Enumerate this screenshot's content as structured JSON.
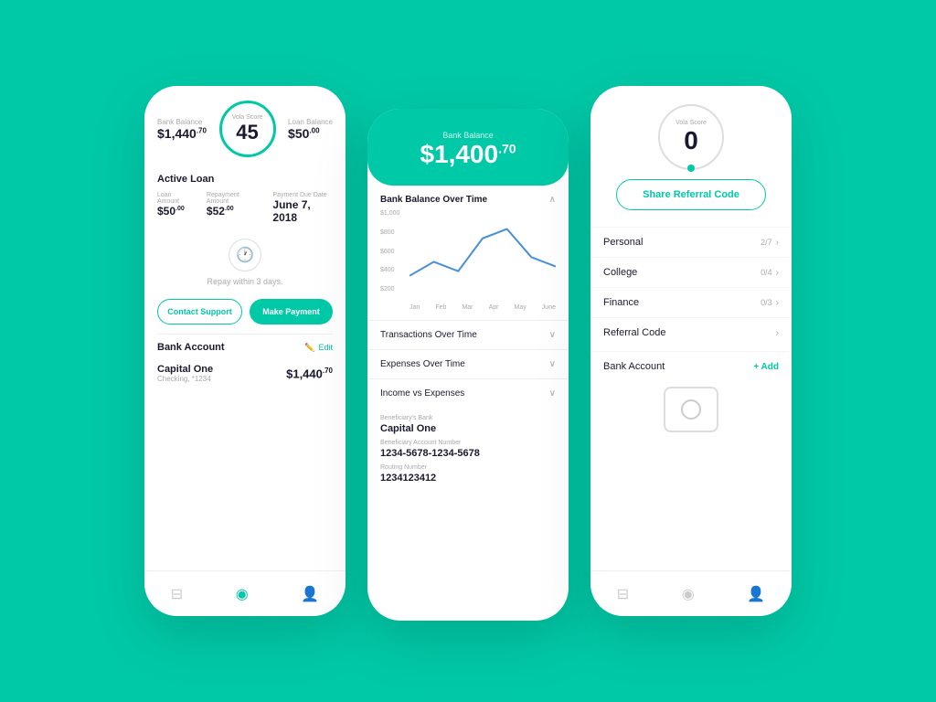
{
  "bg_color": "#00C9A7",
  "phone1": {
    "bank_balance_label": "Bank Balance",
    "bank_balance": "$1,440",
    "bank_balance_sup": ".70",
    "vola_label": "Vola Score",
    "vola_score": "45",
    "loan_balance_label": "Loan Balance",
    "loan_balance": "$50",
    "loan_balance_sup": ".00",
    "active_loan_title": "Active Loan",
    "loan_amount_label": "Loan Amount",
    "loan_amount": "$50",
    "loan_amount_sup": ".00",
    "repayment_label": "Repayment Amount",
    "repayment": "$52",
    "repayment_sup": ".00",
    "due_date_label": "Payment Due Date",
    "due_date": "June 7, 2018",
    "repay_text": "Repay within 3 days.",
    "contact_btn": "Contact Support",
    "payment_btn": "Make Payment",
    "bank_account_title": "Bank Account",
    "edit_label": "Edit",
    "bank_name": "Capital One",
    "bank_type": "Checking, *1234",
    "bank_balance_value": "$1,440",
    "bank_balance_value_sup": ".70"
  },
  "phone2": {
    "bank_balance_label": "Bank Balance",
    "bank_balance": "$1,400",
    "bank_balance_sup": ".70",
    "chart_title": "Bank Balance Over Time",
    "chart_y_labels": [
      "$1,000",
      "$800",
      "$600",
      "$400",
      "$200"
    ],
    "chart_x_labels": [
      "Jan",
      "Feb",
      "Mar",
      "Apr",
      "May",
      "June"
    ],
    "accordions": [
      {
        "label": "Transactions Over Time"
      },
      {
        "label": "Expenses Over Time"
      },
      {
        "label": "Income vs Expenses"
      }
    ],
    "beneficiary_bank_label": "Beneficiary's Bank",
    "beneficiary_bank": "Capital One",
    "beneficiary_account_label": "Beneficiary Account Number",
    "beneficiary_account": "1234-5678-1234-5678",
    "routing_label": "Routing Number",
    "routing": "1234123412"
  },
  "phone3": {
    "vola_label": "Vola Score",
    "vola_score": "0",
    "share_btn": "Share Referral Code",
    "menu_items": [
      {
        "label": "Personal",
        "right": "2/7"
      },
      {
        "label": "College",
        "right": "0/4"
      },
      {
        "label": "Finance",
        "right": "0/3"
      },
      {
        "label": "Referral Code",
        "right": ""
      }
    ],
    "bank_account_label": "Bank Account",
    "add_label": "+ Add"
  },
  "nav": {
    "home": "⊟",
    "globe": "◉",
    "user": "⚇"
  }
}
